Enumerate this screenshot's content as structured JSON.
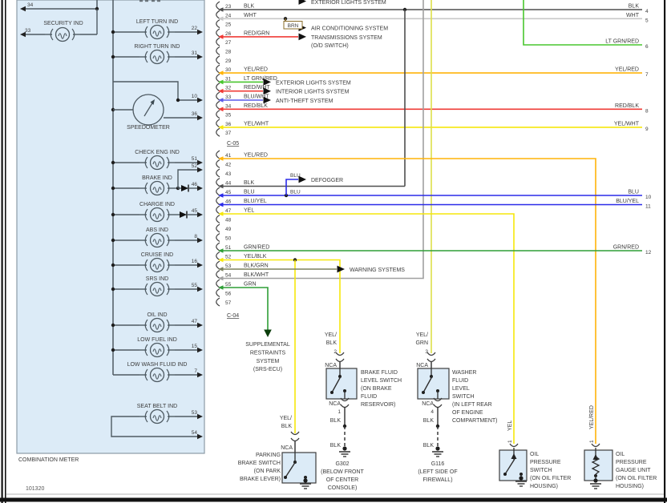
{
  "palette": {
    "wire_blk": "#4f4f4f",
    "wire_wht": "#c8c8c8",
    "wire_brn": "#8a6d2a",
    "wire_red": "#ef3b36",
    "wire_orange": "#ffb409",
    "wire_yel": "#f6e70c",
    "wire_yelgrn": "#dde04a",
    "wire_ltgrn": "#49c62e",
    "wire_grn": "#2f9e37",
    "wire_blu": "#2b2be8",
    "wire_bluwht": "#5a5ae8",
    "wire_blkgrn": "#7b815f",
    "wire_blkwht": "#a0a0a0",
    "meter_fill": "#dcebf7",
    "meter_border": "#8d9ba6",
    "box_border": "#3d3d3d",
    "line": "#4e5a62",
    "text": "#3b3b3b"
  },
  "meter": {
    "label": "COMBINATION METER",
    "security": {
      "name": "SECURITY IND",
      "pin_a": "34",
      "pin_b": "33"
    },
    "turn": [
      {
        "name": "LEFT TURN IND",
        "pin": "22"
      },
      {
        "name": "RIGHT TURN IND",
        "pin": "31"
      }
    ],
    "speedometer": {
      "name": "SPEEDOMETER",
      "pin_a": "10",
      "pin_b": "36"
    },
    "indicators": [
      {
        "name": "CHECK ENG IND",
        "pin": "51"
      },
      {
        "name": "BRAKE IND",
        "pin": "52",
        "pin2": "46"
      },
      {
        "name": "CHARGE IND",
        "pin": "45"
      },
      {
        "name": "ABS IND",
        "pin": "8"
      },
      {
        "name": "CRUISE IND",
        "pin": "16"
      },
      {
        "name": "SRS IND",
        "pin": "55"
      },
      {
        "name": "OIL IND",
        "pin": "47"
      },
      {
        "name": "LOW FUEL IND",
        "pin": "15"
      },
      {
        "name": "LOW WASH FLUID IND",
        "pin": "7"
      }
    ],
    "seat_belt": {
      "name": "SEAT BELT IND",
      "pin_a": "53",
      "pin_b": "54"
    }
  },
  "connectors": {
    "c05": {
      "id": "C-05",
      "pins": [
        {
          "n": "23",
          "label": "BLK"
        },
        {
          "n": "24",
          "label": "WHT"
        },
        {
          "n": "25",
          "label": ""
        },
        {
          "n": "26",
          "label": "RED/GRN"
        },
        {
          "n": "27",
          "label": ""
        },
        {
          "n": "28",
          "label": ""
        },
        {
          "n": "29",
          "label": ""
        },
        {
          "n": "30",
          "label": "YEL/RED"
        },
        {
          "n": "31",
          "label": "LT GRN/RED"
        },
        {
          "n": "32",
          "label": "RED/WHT"
        },
        {
          "n": "33",
          "label": "BLU/WHT"
        },
        {
          "n": "34",
          "label": "RED/BLK"
        },
        {
          "n": "35",
          "label": ""
        },
        {
          "n": "36",
          "label": "YEL/WHT"
        },
        {
          "n": "37",
          "label": ""
        }
      ]
    },
    "c04": {
      "id": "C-04",
      "pins": [
        {
          "n": "41",
          "label": "YEL/RED"
        },
        {
          "n": "42",
          "label": ""
        },
        {
          "n": "43",
          "label": ""
        },
        {
          "n": "44",
          "label": "BLK"
        },
        {
          "n": "45",
          "label": "BLU"
        },
        {
          "n": "46",
          "label": "BLU/YEL"
        },
        {
          "n": "47",
          "label": "YEL"
        },
        {
          "n": "48",
          "label": ""
        },
        {
          "n": "49",
          "label": ""
        },
        {
          "n": "50",
          "label": ""
        },
        {
          "n": "51",
          "label": "GRN/RED"
        },
        {
          "n": "52",
          "label": "YEL/BLK"
        },
        {
          "n": "53",
          "label": "BLK/GRN"
        },
        {
          "n": "54",
          "label": "BLK/WHT"
        },
        {
          "n": "55",
          "label": "GRN"
        },
        {
          "n": "56",
          "label": ""
        },
        {
          "n": "57",
          "label": ""
        }
      ]
    }
  },
  "systems": {
    "exterior_top": "EXTERIOR LIGHTS SYSTEM",
    "air": "AIR CONDITIONING SYSTEM",
    "trans": "TRANSMISSIONS SYSTEM",
    "trans2": "(O/D SWITCH)",
    "exterior": "EXTERIOR LIGHTS SYSTEM",
    "interior": "INTERIOR LIGHTS SYSTEM",
    "antitheft": "ANTI-THEFT SYSTEM",
    "defogger": "DEFOGGER",
    "warning": "WARNING SYSTEMS",
    "brn_tag": "BRN",
    "blu_tag_a": "BLU",
    "blu_tag_b": "BLU",
    "srs": [
      "SUPPLEMENTAL",
      "RESTRAINTS",
      "SYSTEM",
      "(SRS-ECU)"
    ]
  },
  "right_edge": [
    {
      "label": "BLK",
      "n": "4"
    },
    {
      "label": "WHT",
      "n": "5"
    },
    {
      "label": "LT GRN/RED",
      "n": "6"
    },
    {
      "label": "YEL/RED",
      "n": "7"
    },
    {
      "label": "RED/BLK",
      "n": "8"
    },
    {
      "label": "YEL/WHT",
      "n": "9"
    },
    {
      "label": "BLU",
      "n": "10"
    },
    {
      "label": "BLU/YEL",
      "n": "11"
    },
    {
      "label": "GRN/RED",
      "n": "12"
    }
  ],
  "components": {
    "parking": {
      "name": [
        "PARKING",
        "BRAKE SWITCH",
        "(ON PARK",
        "BRAKE LEVER)"
      ],
      "wire": [
        "YEL/",
        "BLK"
      ],
      "nca_top": "NCA"
    },
    "brake_fluid": {
      "name": [
        "BRAKE FLUID",
        "LEVEL SWITCH",
        "(ON BRAKE",
        "FLUID",
        "RESERVOIR)"
      ],
      "wire": [
        "YEL/",
        "BLK"
      ],
      "pin_top": "2",
      "pin_bot": "1",
      "nca_top": "NCA",
      "nca_bot": "NCA",
      "blk1": "BLK",
      "blk2": "BLK",
      "ground": [
        "G302",
        "(BELOW FRONT",
        "OF CENTER",
        "CONSOLE)"
      ]
    },
    "washer": {
      "name": [
        "WASHER",
        "FLUID",
        "LEVEL",
        "SWITCH",
        "(IN LEFT REAR",
        "OF ENGINE",
        "COMPARTMENT)"
      ],
      "wire": [
        "YEL/",
        "GRN"
      ],
      "pin_top": "3",
      "pin_bot": "4",
      "nca_top": "NCA",
      "nca_bot": "NCA",
      "blk1": "BLK",
      "blk2": "BLK",
      "ground": [
        "G116",
        "(LEFT SIDE OF",
        "FIREWALL)"
      ]
    },
    "oil_switch": {
      "name": [
        "OIL",
        "PRESSURE",
        "SWITCH",
        "(ON OIL FILTER",
        "HOUSING)"
      ],
      "wire": "YEL",
      "pin": "1"
    },
    "oil_gauge": {
      "name": [
        "OIL",
        "PRESSURE",
        "GAUGE UNIT",
        "(ON OIL FILTER",
        "HOUSING)"
      ],
      "wire": "YEL/RED",
      "pin": "1"
    }
  },
  "footer": "101320"
}
